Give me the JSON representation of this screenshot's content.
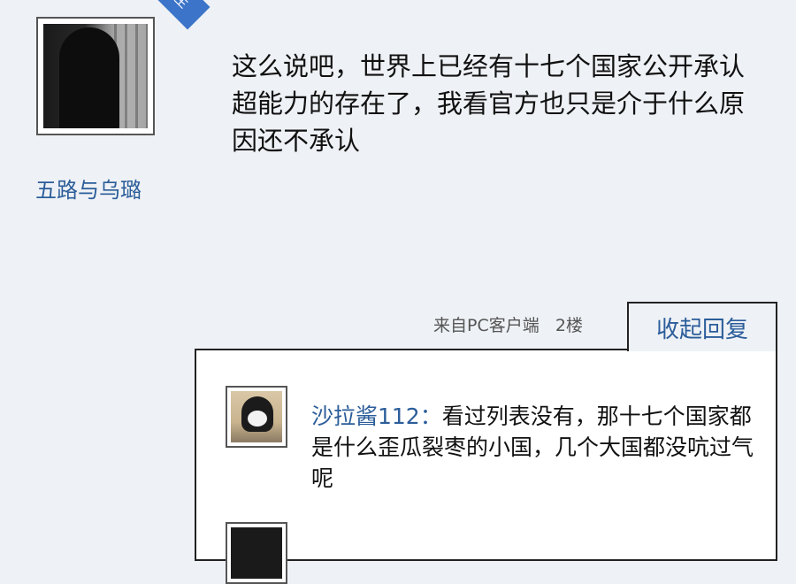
{
  "post": {
    "badge": "楼主",
    "author": "五路与乌璐",
    "content": "这么说吧，世界上已经有十七个国家公开承认超能力的存在了，我看官方也只是介于什么原因还不承认",
    "source": "来自PC客户端",
    "floor": "2楼",
    "collapse_label": "收起回复"
  },
  "replies": [
    {
      "user": "沙拉酱112：",
      "text": "看过列表没有，那十七个国家都是什么歪瓜裂枣的小国，几个大国都没吭过气呢"
    }
  ],
  "colors": {
    "accent": "#2b5d9a",
    "badge": "#3b74c8",
    "background": "#eef1f5"
  }
}
